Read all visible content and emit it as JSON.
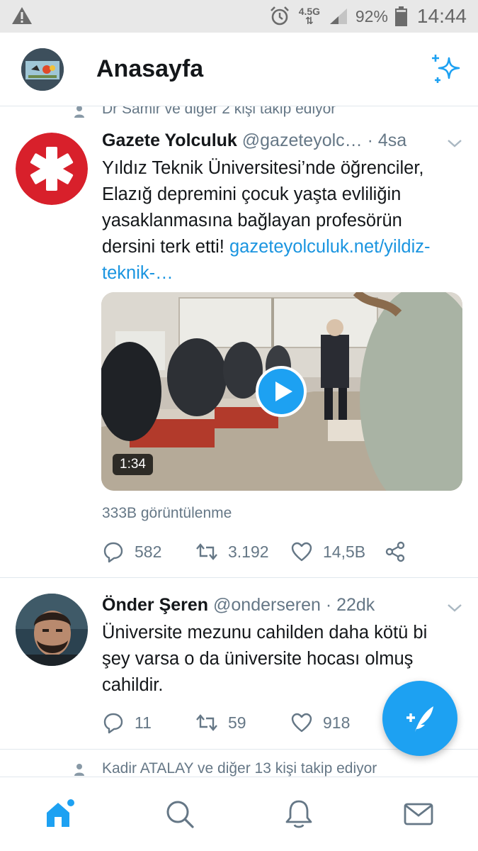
{
  "status_bar": {
    "network": "4.5G",
    "battery": "92%",
    "time": "14:44"
  },
  "header": {
    "title": "Anasayfa"
  },
  "feed": {
    "social_top": "Dr Samir ve diğer 2 kişi takip ediyor",
    "tweets": [
      {
        "name": "Gazete Yolculuk",
        "meta": "@gazeteyolc… · 4sa",
        "text": "Yıldız Teknik Üniversitesi’nde öğrenciler, Elazığ depremini çocuk yaşta evliliğin yasaklanmasına bağlayan profesörün dersini terk etti!",
        "link": "gazeteyolculuk.net/yildiz-teknik-…",
        "video_duration": "1:34",
        "views": "333B görüntülenme",
        "replies": "582",
        "retweets": "3.192",
        "likes": "14,5B"
      },
      {
        "name": "Önder Şeren",
        "meta": "@onderseren · 22dk",
        "text": "Üniversite mezunu cahilden daha kötü bi şey varsa o da üniversite hocası olmuş cahildir.",
        "replies": "11",
        "retweets": "59",
        "likes": "918"
      }
    ],
    "social_bottom": "Kadir ATALAY ve diğer 13 kişi takip ediyor"
  },
  "colors": {
    "accent": "#1da1f2",
    "link": "#1b95e0",
    "muted": "#657786",
    "text": "#14171a",
    "status_bar_bg": "#e8e8e8"
  },
  "icons": {
    "status": [
      "warning-icon",
      "alarm-icon",
      "signal-icon",
      "battery-icon"
    ],
    "header": [
      "sparkle-icon"
    ],
    "actions": [
      "reply-icon",
      "retweet-icon",
      "like-icon",
      "share-icon"
    ],
    "nav": [
      "home-icon",
      "search-icon",
      "notifications-icon",
      "messages-icon"
    ],
    "fab": "compose-tweet-icon"
  }
}
